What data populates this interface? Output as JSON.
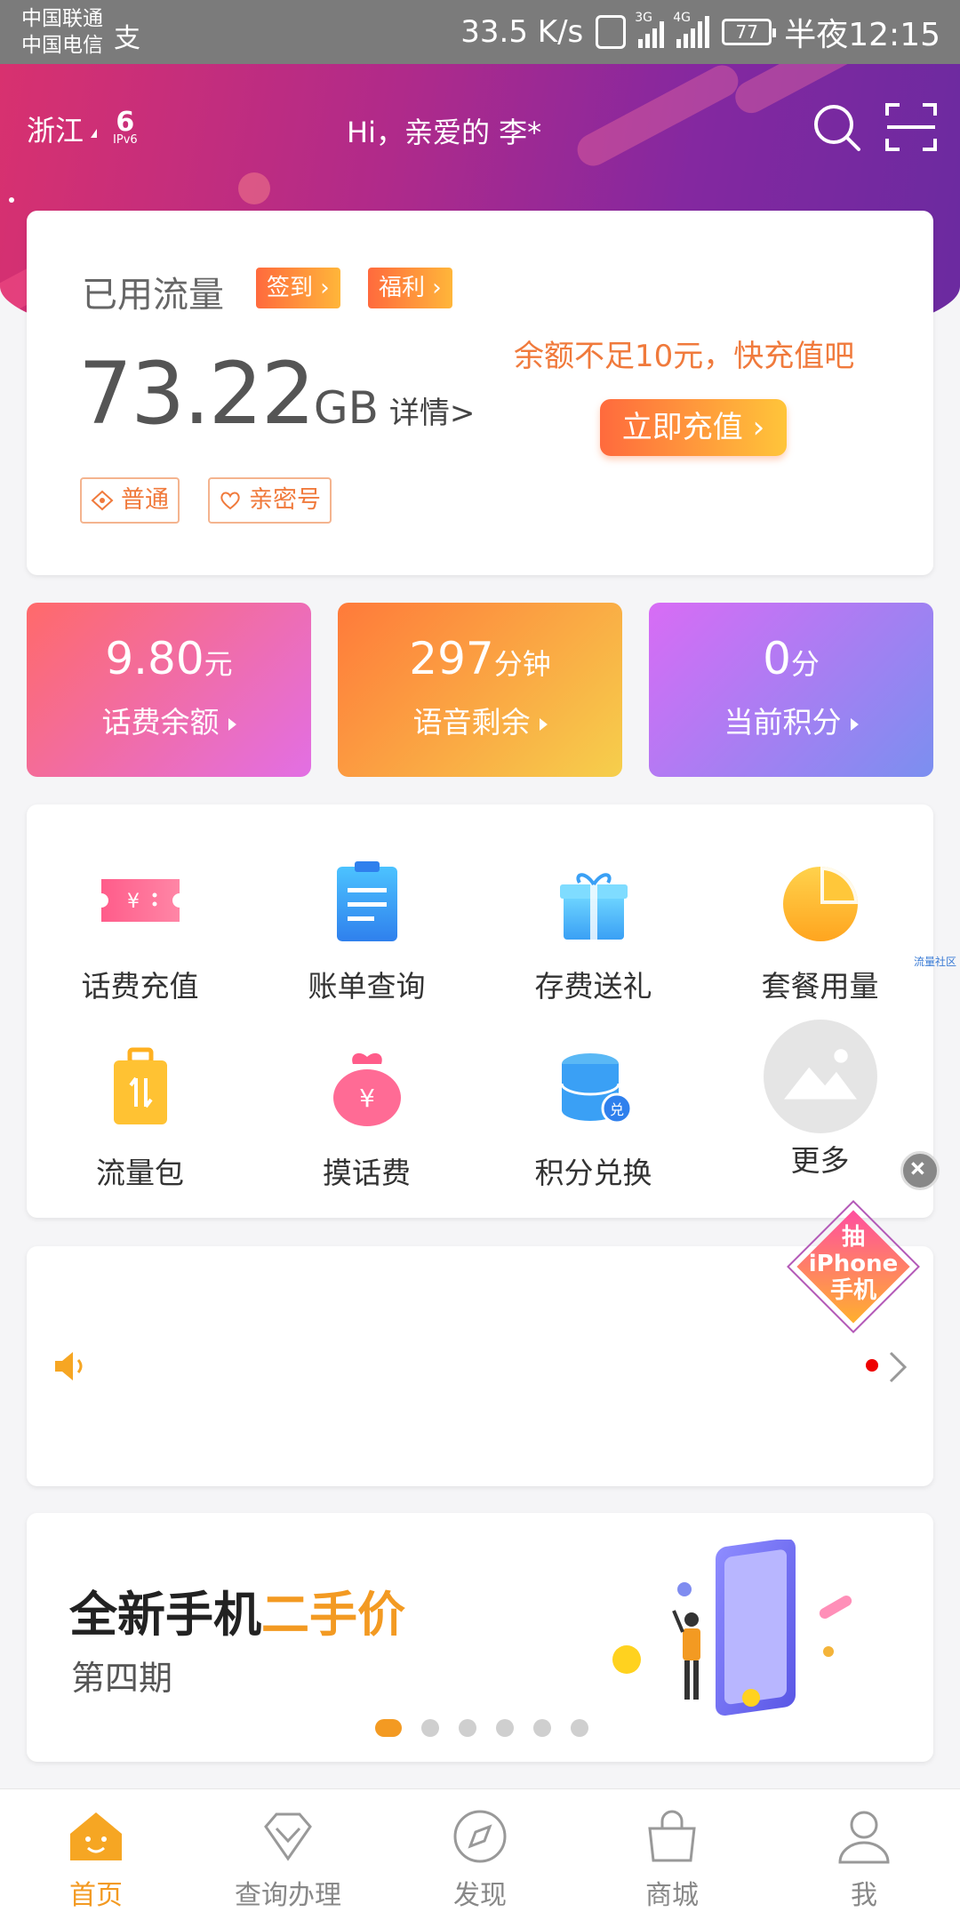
{
  "status_bar": {
    "carrier1": "中国联通",
    "carrier2": "中国电信",
    "net_speed": "33.5 K/s",
    "signal1": "3G",
    "signal2": "4G",
    "battery": "77",
    "time": "半夜12:15"
  },
  "header": {
    "region": "浙江",
    "ipv6_label": "IPv6",
    "greeting": "Hi，亲爱的 李*"
  },
  "usage": {
    "title": "已用流量",
    "signin_label": "签到 ›",
    "welfare_label": "福利 ›",
    "amount": "73.22",
    "unit": "GB",
    "detail_link": "详情>",
    "badge_normal": "普通",
    "badge_family": "亲密号",
    "warning": "余额不足10元，快充值吧",
    "recharge_button": "立即充值 ›"
  },
  "stats": [
    {
      "value": "9.80",
      "unit": "元",
      "label": "话费余额"
    },
    {
      "value": "297",
      "unit": "分钟",
      "label": "语音剩余"
    },
    {
      "value": "0",
      "unit": "分",
      "label": "当前积分"
    }
  ],
  "services": [
    {
      "label": "话费充值",
      "icon": "ticket-icon"
    },
    {
      "label": "账单查询",
      "icon": "bill-icon"
    },
    {
      "label": "存费送礼",
      "icon": "gift-icon"
    },
    {
      "label": "套餐用量",
      "icon": "pie-icon"
    },
    {
      "label": "流量包",
      "icon": "luggage-icon"
    },
    {
      "label": "摸话费",
      "icon": "money-bag-icon"
    },
    {
      "label": "积分兑换",
      "icon": "database-exchange-icon"
    },
    {
      "label": "更多",
      "icon": "image-placeholder-icon"
    }
  ],
  "side_text": "流量社区",
  "float_promo": {
    "line1": "抽",
    "line2": "iPhone",
    "line3": "手机"
  },
  "promo": {
    "title_part1": "全新手机",
    "title_part2": "二手价",
    "subtitle": "第四期"
  },
  "nav": [
    {
      "label": "首页",
      "icon": "home-icon",
      "active": true
    },
    {
      "label": "查询办理",
      "icon": "diamond-icon",
      "active": false
    },
    {
      "label": "发现",
      "icon": "compass-icon",
      "active": false
    },
    {
      "label": "商城",
      "icon": "shopping-bag-icon",
      "active": false
    },
    {
      "label": "我",
      "icon": "user-icon",
      "active": false
    }
  ],
  "colors": {
    "accent": "#f39a22",
    "header_start": "#d8316f",
    "header_end": "#6a2aa0"
  }
}
